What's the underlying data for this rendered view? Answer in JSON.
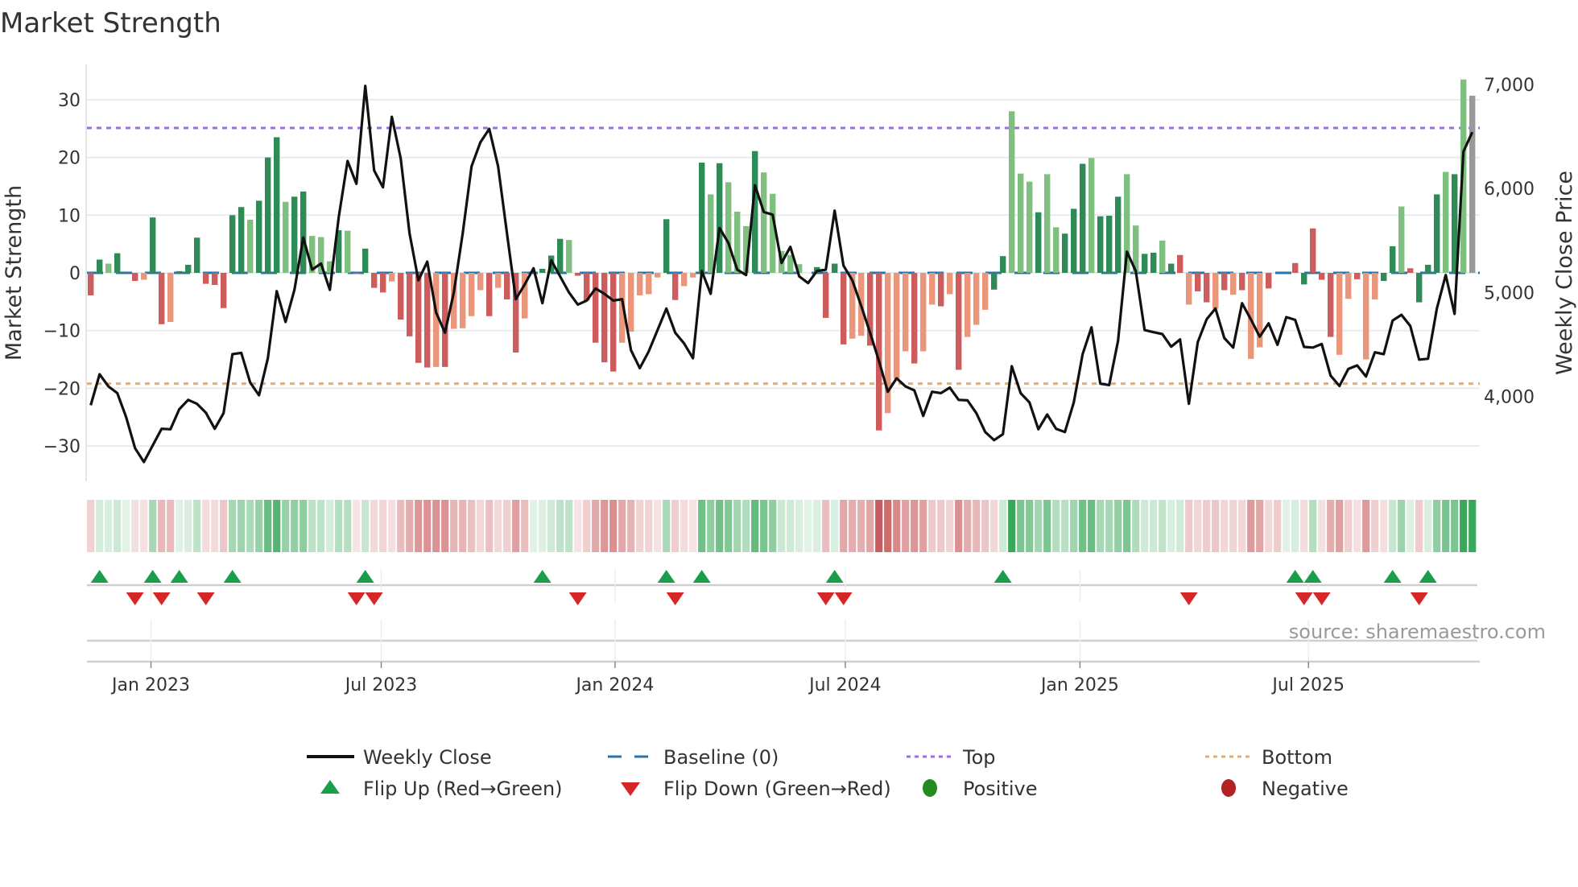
{
  "chart_data": {
    "type": "bar",
    "title": "Market Strength",
    "ylabel": "Market Strength",
    "y2label": "Weekly Close Price",
    "ylim": [
      -37,
      37
    ],
    "y_ticks": [
      -30,
      -20,
      -10,
      0,
      10,
      20,
      30
    ],
    "y_tick_labels": [
      "−30",
      "−20",
      "−10",
      "0",
      "10",
      "20",
      "30"
    ],
    "y2lim": [
      3250,
      7200
    ],
    "y2_ticks": [
      4000,
      5000,
      6000,
      7000
    ],
    "y2_tick_labels": [
      "4,000",
      "5,000",
      "6,000",
      "7,000"
    ],
    "x_ticks": [
      {
        "label": "Jan 2023",
        "week_index": 6.8
      },
      {
        "label": "Jul 2023",
        "week_index": 32.8
      },
      {
        "label": "Jan 2024",
        "week_index": 59.2
      },
      {
        "label": "Jul 2024",
        "week_index": 85.2
      },
      {
        "label": "Jan 2025",
        "week_index": 111.7
      },
      {
        "label": "Jul 2025",
        "week_index": 137.5
      }
    ],
    "top_level": 25.1,
    "bottom_level": -19.2,
    "baseline": 0,
    "strength": [
      -3.9,
      2.3,
      1.6,
      3.4,
      0,
      -1.4,
      -1.2,
      9.6,
      -8.9,
      -8.5,
      0.3,
      1.4,
      6.1,
      -1.9,
      -2.1,
      -6.1,
      10,
      11.4,
      9.2,
      12.5,
      20,
      23.5,
      12.3,
      13.2,
      14.1,
      6.4,
      6.2,
      2,
      7.4,
      7.3,
      -0.2,
      4.2,
      -2.6,
      -3.4,
      -1.5,
      -8.1,
      -11,
      -15.6,
      -16.4,
      -16.3,
      -16.3,
      -9.7,
      -9.6,
      -7.5,
      -3.0,
      -7.5,
      -2.6,
      -4.6,
      -13.8,
      -7.9,
      0,
      0.7,
      3.0,
      5.9,
      5.7,
      -0.5,
      -4.8,
      -12.1,
      -15.5,
      -17.1,
      -12.1,
      -10.2,
      -3.9,
      -3.7,
      -0.8,
      9.3,
      -4.7,
      -2.3,
      -0.8,
      19.1,
      13.6,
      19,
      15.7,
      10.6,
      8.1,
      21.1,
      17.4,
      13.7,
      3.8,
      3.1,
      1.5,
      0,
      1.0,
      -7.8,
      1.6,
      -12.4,
      -11.4,
      -10.9,
      -12.6,
      -27.3,
      -24.3,
      -18.4,
      -13.6,
      -15.7,
      -13.6,
      -5.5,
      -5.8,
      -3.7,
      -16.8,
      -11.1,
      -9.0,
      -6.4,
      -2.9,
      2.9,
      28.0,
      17.2,
      15.8,
      10.5,
      17.1,
      7.9,
      6.8,
      11.1,
      18.9,
      19.9,
      9.8,
      9.9,
      13.2,
      17.1,
      8.2,
      3.3,
      3.5,
      5.6,
      1.6,
      3.1,
      -5.5,
      -3.2,
      -5.1,
      -6.2,
      -3.0,
      -3.8,
      -3.0,
      -14.9,
      -12.9,
      -2.7,
      -5.0,
      0,
      1.7,
      -2.0,
      7.7,
      -1.2,
      -11.1,
      -14.2,
      -4.5,
      -1.1,
      -15.0,
      -4.6,
      -1.4,
      4.6,
      11.5,
      0.8,
      -5.1,
      1.4,
      13.6,
      17.5,
      17.1,
      33.5,
      30.7
    ],
    "shade": "RGgG0RrGRrGGGRRRGGgGGGgGGgggGgRGRRrRRRRrRrrrrRrRRr0GGGgRRRRRrrrrrGRrrGgGgggGggggg0GRGRrrRRrrrRrrRrRrrrGGgggGggGGGgGGGggGGgGRrRRrRrRrrR0GRGRRRrrRrrGGgRGGGgGg",
    "weekly_close": [
      3916,
      4213,
      4096,
      4032,
      3800,
      3503,
      3369,
      3529,
      3689,
      3684,
      3877,
      3967,
      3929,
      3844,
      3689,
      3839,
      4406,
      4419,
      4135,
      4011,
      4367,
      5012,
      4716,
      5025,
      5528,
      5219,
      5278,
      5025,
      5722,
      6264,
      6044,
      6986,
      6173,
      6011,
      6689,
      6289,
      5567,
      5116,
      5296,
      4806,
      4612,
      5000,
      5567,
      6212,
      6444,
      6573,
      6212,
      5567,
      4935,
      5077,
      5232,
      4896,
      5309,
      5154,
      5000,
      4883,
      4922,
      5038,
      4987,
      4922,
      4935,
      4445,
      4272,
      4432,
      4638,
      4845,
      4612,
      4509,
      4367,
      5206,
      4987,
      5619,
      5477,
      5219,
      5167,
      6031,
      5773,
      5748,
      5283,
      5438,
      5154,
      5090,
      5206,
      5219,
      5786,
      5257,
      5116,
      4870,
      4612,
      4342,
      4045,
      4174,
      4096,
      4058,
      3813,
      4045,
      4032,
      4084,
      3967,
      3962,
      3839,
      3658,
      3580,
      3637,
      4290,
      4032,
      3942,
      3684,
      3826,
      3689,
      3658,
      3942,
      4406,
      4664,
      4122,
      4109,
      4535,
      5392,
      5206,
      4638,
      4618,
      4600,
      4478,
      4548,
      3929,
      4522,
      4741,
      4845,
      4561,
      4470,
      4896,
      4741,
      4574,
      4703,
      4496,
      4762,
      4736,
      4476,
      4470,
      4504,
      4200,
      4101,
      4264,
      4298,
      4192,
      4424,
      4406,
      4729,
      4785,
      4677,
      4354,
      4362,
      4845,
      5167,
      4793,
      6354,
      6542
    ],
    "flip_up_weeks": [
      2,
      8,
      11,
      17,
      32,
      52,
      66,
      70,
      85,
      104,
      137,
      139,
      148,
      152
    ],
    "flip_down_weeks": [
      6,
      9,
      14,
      31,
      33,
      56,
      67,
      84,
      86,
      125,
      138,
      140,
      151
    ],
    "legend": {
      "placement": "bottom",
      "items": [
        {
          "label": "Weekly Close",
          "kind": "line"
        },
        {
          "label": "Baseline (0)",
          "kind": "baseline"
        },
        {
          "label": "Top",
          "kind": "top"
        },
        {
          "label": "Bottom",
          "kind": "bottom"
        },
        {
          "label": "Flip Up (Red→Green)",
          "kind": "flip-up"
        },
        {
          "label": "Flip Down (Green→Red)",
          "kind": "flip-down"
        },
        {
          "label": "Positive",
          "kind": "positive"
        },
        {
          "label": "Negative",
          "kind": "negative"
        }
      ]
    },
    "source": "source: sharemaestro.com",
    "colors": {
      "pos_strong": "#2e8b57",
      "pos_weak": "#7fbf7f",
      "neg_strong": "#cd5c5c",
      "neg_weak": "#e9967a",
      "close": "#111111",
      "baseline": "#2a73a8",
      "top": "#9b6ee0",
      "bottom": "#f0a868",
      "flip_up": "#1a9e4a",
      "flip_down": "#d62728",
      "positive": "#228b22",
      "negative": "#b22222",
      "grid": "#e8eaee"
    }
  }
}
